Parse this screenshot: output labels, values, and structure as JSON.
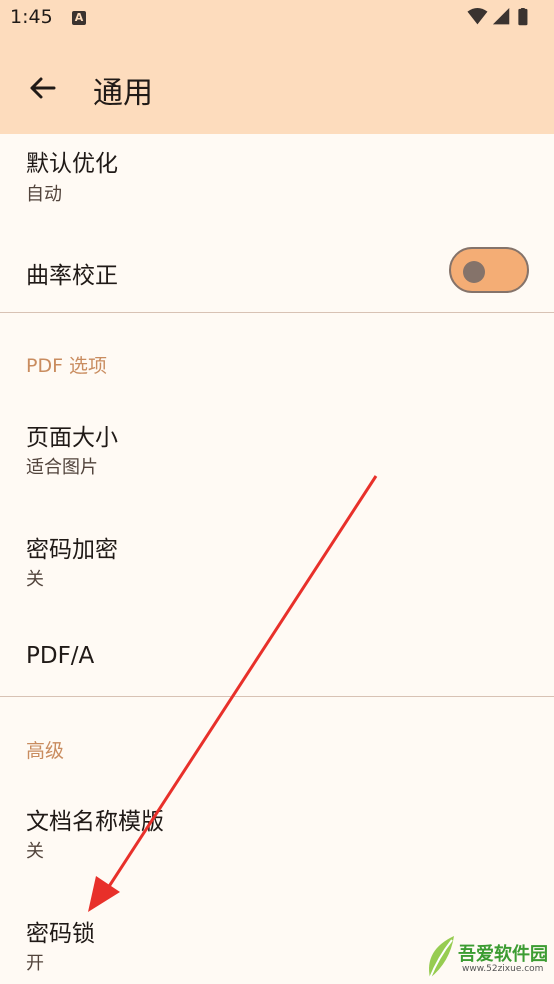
{
  "status_bar": {
    "time": "1:45",
    "notification_icon_letter": "A",
    "icons": [
      "wifi-icon",
      "signal-icon",
      "battery-icon"
    ]
  },
  "app_bar": {
    "title": "通用",
    "back_icon": "arrow-left-icon"
  },
  "items": {
    "default_optimize": {
      "title": "默认优化",
      "subtitle": "自动"
    },
    "curvature_correction": {
      "title": "曲率校正",
      "toggle_on": false
    },
    "pdf_section": "PDF 选项",
    "page_size": {
      "title": "页面大小",
      "subtitle": "适合图片"
    },
    "password_encrypt": {
      "title": "密码加密",
      "subtitle": "关"
    },
    "pdfa": {
      "title": "PDF/A"
    },
    "advanced_section": "高级",
    "doc_name_template": {
      "title": "文档名称模版",
      "subtitle": "关"
    },
    "password_lock": {
      "title": "密码锁",
      "subtitle": "开"
    }
  },
  "watermark": {
    "text": "吾爱软件园",
    "url": "www.52zixue.com"
  },
  "colors": {
    "app_bar": "#fddcbd",
    "background": "#fffaf4",
    "accent": "#c98c5f",
    "toggle_track": "#f4ad75",
    "annotation_arrow": "#e8302a"
  }
}
